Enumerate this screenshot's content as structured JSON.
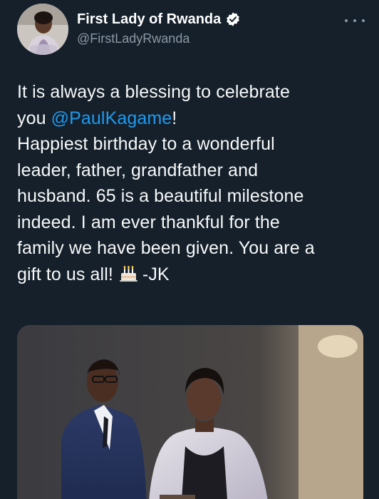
{
  "tweet": {
    "author": {
      "display_name": "First Lady of Rwanda",
      "handle": "@FirstLadyRwanda",
      "verified": true,
      "verified_icon": "verified-badge-icon",
      "avatar_icon": "profile-avatar"
    },
    "more_icon": "more-options-icon",
    "text": {
      "line1": "It is always a blessing to celebrate",
      "line2_prefix": "you ",
      "mention": "@PaulKagame",
      "line2_suffix": "!",
      "line3": "Happiest birthday to a wonderful",
      "line4": "leader, father, grandfather and",
      "line5": "husband. 65 is a beautiful milestone",
      "line6": "indeed. I am ever thankful for the",
      "line7": "family we have been given. You are a",
      "line8_prefix": "gift to us all!",
      "line8_emoji": "birthday-cake-emoji",
      "line8_suffix": "-JK"
    },
    "media": {
      "type": "photo"
    }
  },
  "colors": {
    "background": "#15202b",
    "text": "#f7f9f9",
    "secondary_text": "#8b98a5",
    "link": "#1d9bf0",
    "verified_badge": "#ffffff"
  }
}
